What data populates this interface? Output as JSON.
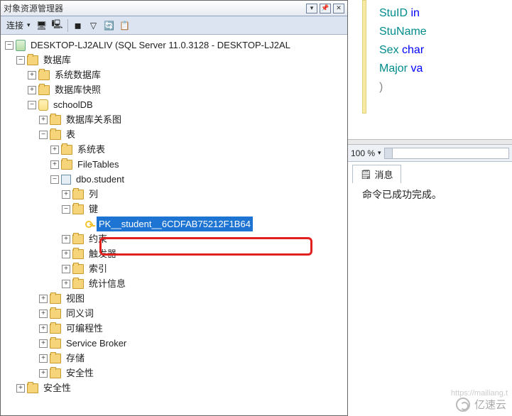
{
  "panel": {
    "title": "对象资源管理器",
    "connect_label": "连接"
  },
  "tree": {
    "server": "DESKTOP-LJ2ALIV (SQL Server 11.0.3128 - DESKTOP-LJ2AL",
    "databases": "数据库",
    "sysdb": "系统数据库",
    "snapshot": "数据库快照",
    "userdb": "schoolDB",
    "diagrams": "数据库关系图",
    "tables": "表",
    "systables": "系统表",
    "filetables": "FileTables",
    "table_name": "dbo.student",
    "columns": "列",
    "keys": "键",
    "pk": "PK__student__6CDFAB75212F1B64",
    "constraints": "约束",
    "triggers": "触发器",
    "indexes": "索引",
    "stats": "统计信息",
    "views": "视图",
    "synonyms": "同义词",
    "programmability": "可编程性",
    "service_broker": "Service Broker",
    "storage": "存储",
    "security": "安全性",
    "security2": "安全性"
  },
  "editor": {
    "l1a": "StuID",
    "l1b": "in",
    "l2a": "StuName",
    "l3a": "Sex",
    "l3b": "char",
    "l4a": "Major",
    "l4b": "va",
    "l5": ")"
  },
  "zoom": "100 %",
  "messages_tab": "消息",
  "messages_body": "命令已成功完成。",
  "watermark": "亿速云",
  "wm_url": "https://mailiang.t"
}
